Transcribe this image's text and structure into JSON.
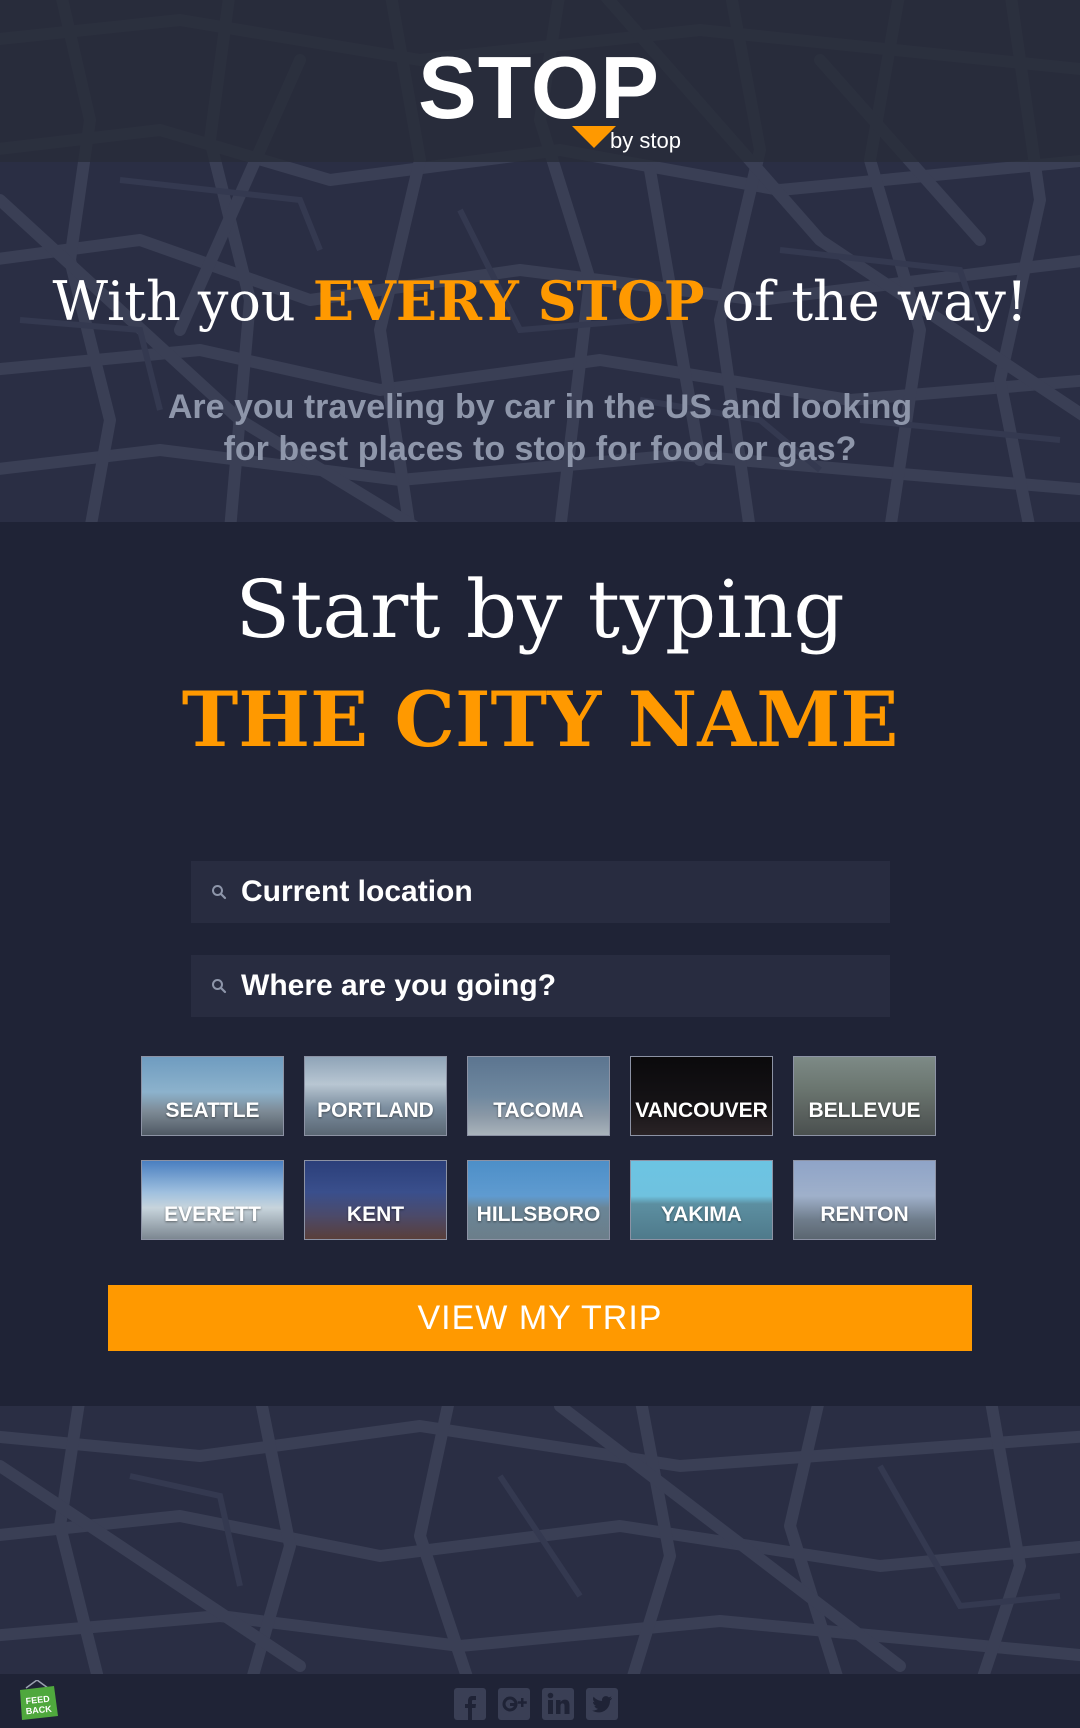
{
  "logo": {
    "wordmark": "STOP",
    "subtitle": "by stop"
  },
  "hero": {
    "tagline_before": "With you",
    "tagline_accent": "EVERY STOP",
    "tagline_after": "of the way!",
    "intro": "Are you traveling by car in the US and looking for best places to stop for food or gas?"
  },
  "prompt": {
    "line1": "Start by typing",
    "line2": "THE CITY NAME"
  },
  "search": {
    "from_placeholder": "Current location",
    "to_placeholder": "Where are you going?",
    "icon": "search-icon"
  },
  "cities": [
    {
      "name": "SEATTLE"
    },
    {
      "name": "PORTLAND"
    },
    {
      "name": "TACOMA"
    },
    {
      "name": "VANCOUVER"
    },
    {
      "name": "BELLEVUE"
    },
    {
      "name": "EVERETT"
    },
    {
      "name": "KENT"
    },
    {
      "name": "HILLSBORO"
    },
    {
      "name": "YAKIMA"
    },
    {
      "name": "RENTON"
    }
  ],
  "cta": {
    "label": "VIEW MY TRIP"
  },
  "footer": {
    "social_icons": [
      "facebook-icon",
      "google-plus-icon",
      "linkedin-icon",
      "twitter-icon"
    ],
    "feedback_badge": "FEED BACK"
  },
  "colors": {
    "background": "#1f2336",
    "accent": "#ff9900",
    "field": "#282c40",
    "intro_text": "#8e96aa",
    "map_lines": "#363b50"
  }
}
